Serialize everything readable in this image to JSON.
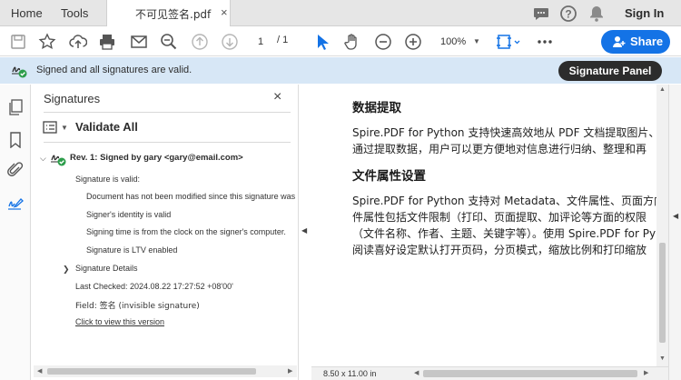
{
  "tabbar": {
    "home": "Home",
    "tools": "Tools",
    "document_tab": "不可见签名.pdf",
    "close": "×",
    "sign_in": "Sign In",
    "icons": [
      "chat-icon",
      "help-icon",
      "bell-icon"
    ]
  },
  "toolbar": {
    "page_current": "1",
    "page_total": "/ 1",
    "zoom": "100%",
    "zoom_caret": "▼",
    "share": "Share",
    "accent_color": "#1473e6",
    "icons": [
      "save-icon",
      "bookmark-star-icon",
      "upload-icon",
      "print-icon",
      "email-icon",
      "zoom-search-icon",
      "page-up-icon",
      "page-down-icon",
      "select-cursor-icon",
      "hand-icon",
      "zoom-out-icon",
      "zoom-in-icon",
      "fit-page-icon",
      "more-icon"
    ]
  },
  "sigbar": {
    "message": "Signed and all signatures are valid.",
    "panel_button": "Signature Panel",
    "bg_color": "#d7e7f6"
  },
  "rail": {
    "icons": [
      "pages-icon",
      "bookmark-icon",
      "attachment-icon",
      "signature-pen-icon"
    ]
  },
  "panel": {
    "title": "Signatures",
    "close": "×",
    "validate_all": "Validate All",
    "rev_label": "Rev. 1: Signed by gary <gary@email.com>",
    "sig_valid": "Signature is valid:",
    "not_modified": "Document has not been modified since this signature was",
    "identity_valid": "Signer's identity is valid",
    "signing_time": "Signing time is from the clock on the signer's computer.",
    "ltv": "Signature is LTV enabled",
    "details": "Signature Details",
    "last_checked": "Last Checked: 2024.08.22 17:27:52 +08'00'",
    "field": "Field: 签名 (invisible signature)",
    "view_version": "Click to view this version"
  },
  "document": {
    "heading1": "数据提取",
    "para1_line1": "Spire.PDF for Python 支持快速高效地从 PDF 文档提取图片、文",
    "para1_line2": "通过提取数据，用户可以更方便地对信息进行归纳、整理和再",
    "heading2": "文件属性设置",
    "para2_line1": "Spire.PDF for Python 支持对 Metadata、文件属性、页面方向、",
    "para2_line2": "件属性包括文件限制（打印、页面提取、加评论等方面的权限",
    "para2_line3": "（文件名称、作者、主题、关键字等）。使用 Spire.PDF for Py",
    "para2_line4": "阅读喜好设定默认打开页码，分页模式，缩放比例和打印缩放"
  },
  "status": {
    "page_size": "8.50 x 11.00 in"
  }
}
